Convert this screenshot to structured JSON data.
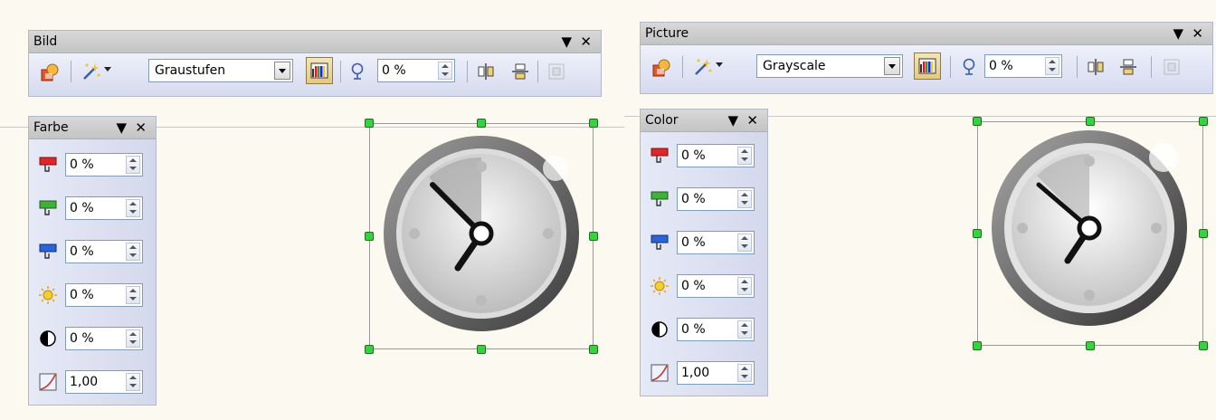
{
  "left": {
    "toolbar": {
      "title": "Bild",
      "mode": "Graustufen",
      "transparency": "0 %"
    },
    "color_panel": {
      "title": "Farbe",
      "rows": [
        {
          "icon": "red-icon",
          "value": "0 %"
        },
        {
          "icon": "green-icon",
          "value": "0 %"
        },
        {
          "icon": "blue-icon",
          "value": "0 %"
        },
        {
          "icon": "brightness-icon",
          "value": "0 %"
        },
        {
          "icon": "contrast-icon",
          "value": "0 %"
        },
        {
          "icon": "gamma-icon",
          "value": "1,00"
        }
      ]
    }
  },
  "right": {
    "toolbar": {
      "title": "Picture",
      "mode": "Grayscale",
      "transparency": "0 %"
    },
    "color_panel": {
      "title": "Color",
      "rows": [
        {
          "icon": "red-icon",
          "value": "0 %"
        },
        {
          "icon": "green-icon",
          "value": "0 %"
        },
        {
          "icon": "blue-icon",
          "value": "0 %"
        },
        {
          "icon": "brightness-icon",
          "value": "0 %"
        },
        {
          "icon": "contrast-icon",
          "value": "0 %"
        },
        {
          "icon": "gamma-icon",
          "value": "1,00"
        }
      ]
    }
  },
  "controls": {
    "menu_glyph": "▼",
    "close_glyph": "✕"
  }
}
